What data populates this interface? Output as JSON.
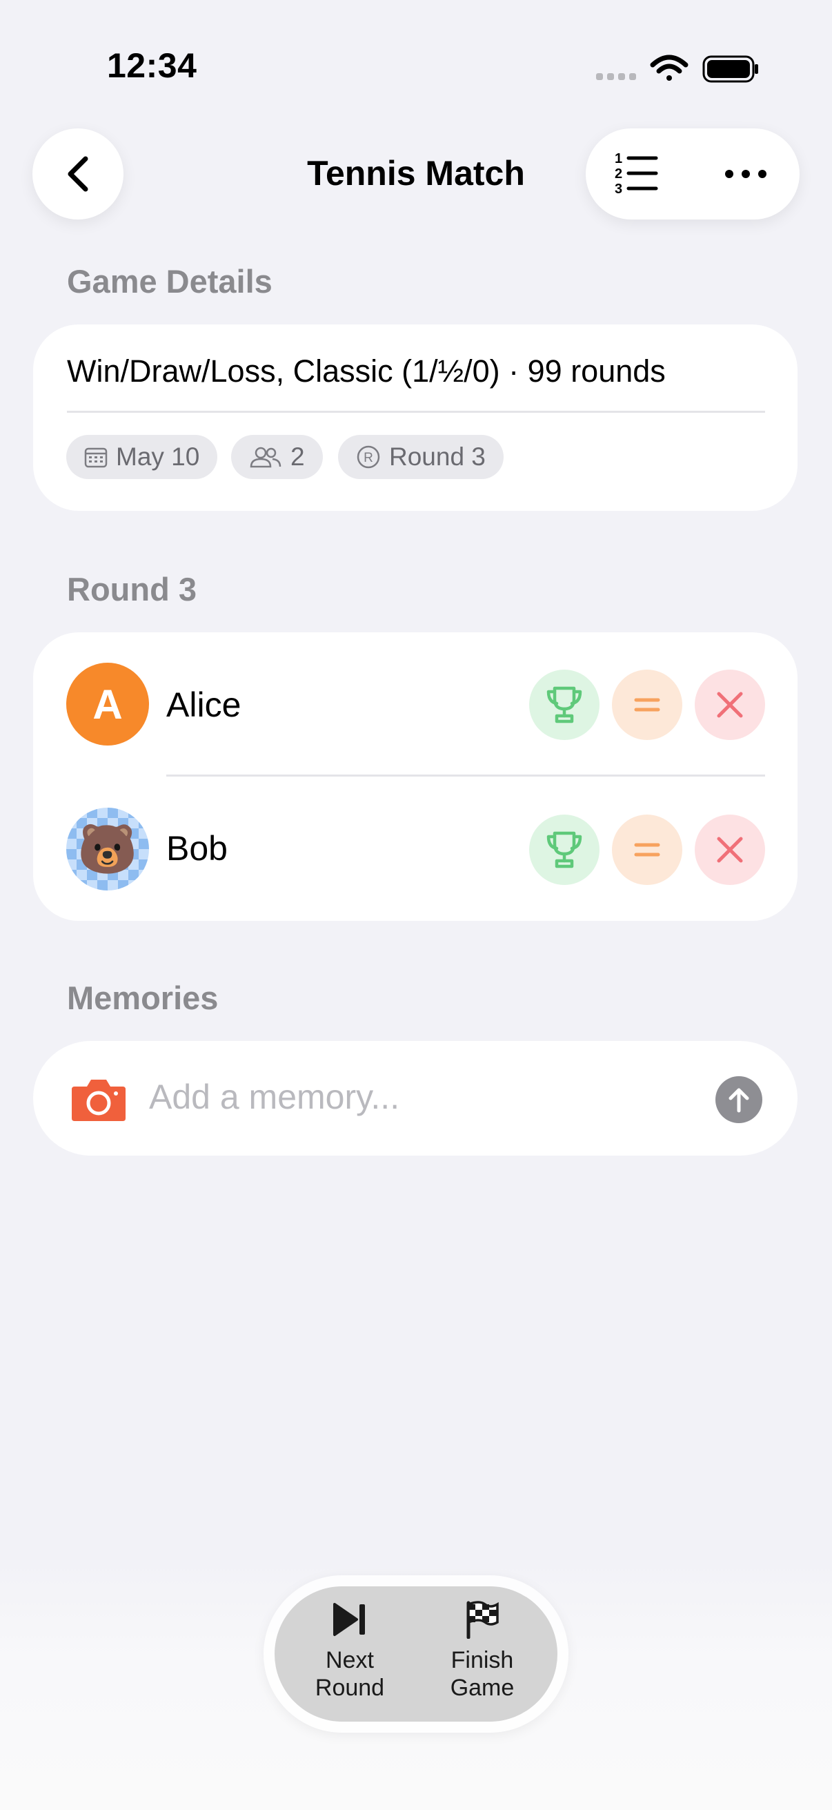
{
  "status_bar": {
    "time": "12:34"
  },
  "nav": {
    "title": "Tennis Match"
  },
  "game_details": {
    "heading": "Game Details",
    "summary": "Win/Draw/Loss, Classic (1/½/0) · 99 rounds",
    "chips": {
      "date": "May 10",
      "players": "2",
      "round": "Round 3"
    }
  },
  "round": {
    "heading": "Round 3",
    "players": [
      {
        "name": "Alice",
        "initial": "A"
      },
      {
        "name": "Bob",
        "avatar": "🐻"
      }
    ]
  },
  "memories": {
    "heading": "Memories",
    "placeholder": "Add a memory..."
  },
  "toolbar": {
    "next_label": "Next\nRound",
    "finish_label": "Finish\nGame"
  },
  "colors": {
    "alice_avatar": "#f7892a",
    "win_icon": "#5fc97a",
    "draw_icon": "#f7a25e",
    "loss_icon": "#f07078",
    "camera_icon": "#f0603c"
  }
}
